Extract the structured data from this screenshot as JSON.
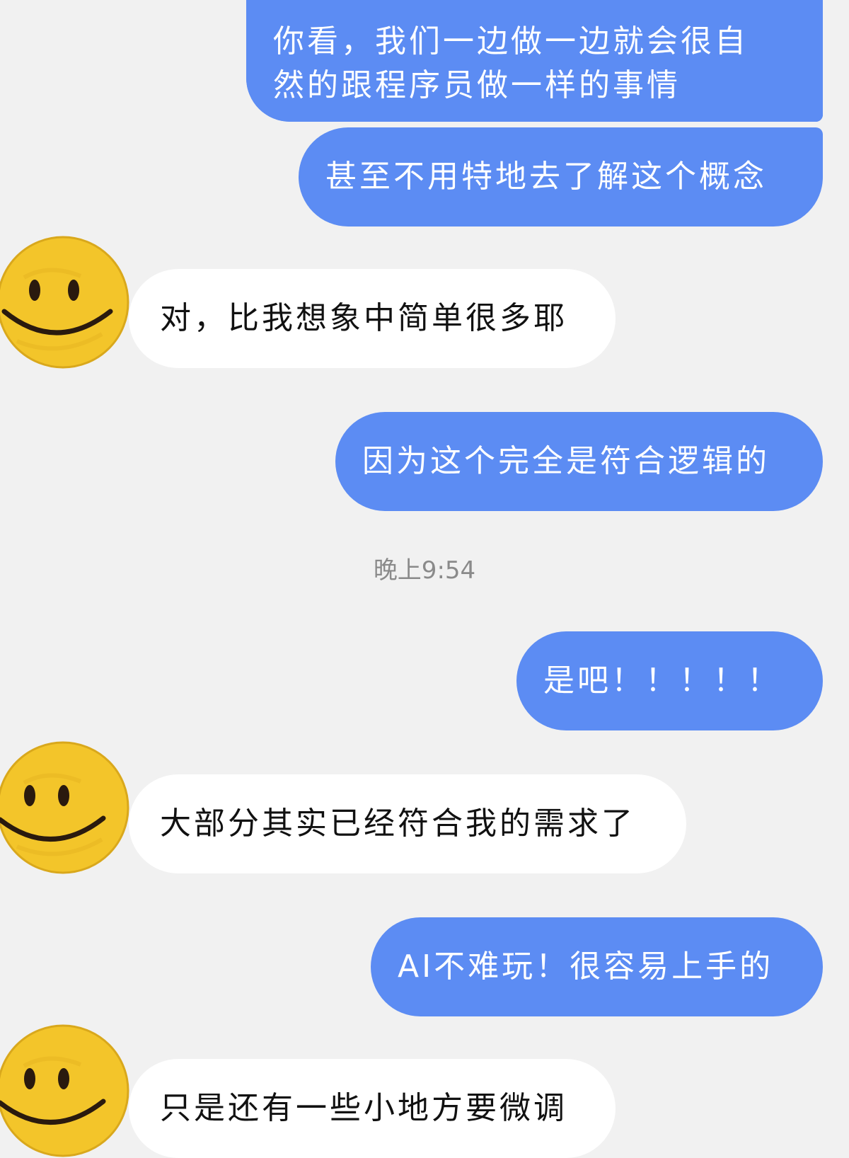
{
  "messages": [
    {
      "side": "out",
      "lines": [
        "你看，我们一边做一边就会很自",
        "然的跟程序员做一样的事情"
      ]
    },
    {
      "side": "out",
      "text": "甚至不用特地去了解这个概念"
    },
    {
      "side": "in",
      "text": "对，比我想象中简单很多耶"
    },
    {
      "side": "out",
      "text": "因为这个完全是符合逻辑的"
    },
    {
      "side": "out",
      "text": "是吧！！！！！"
    },
    {
      "side": "in",
      "text": "大部分其实已经符合我的需求了"
    },
    {
      "side": "out",
      "text": "AI不难玩！很容易上手的"
    },
    {
      "side": "in",
      "text": "只是还有一些小地方要微调"
    }
  ],
  "timestamp": "晚上9:54",
  "avatar_icon": "smiley-face-icon",
  "colors": {
    "background": "#f1f1f1",
    "outgoing_bubble": "#5c8cf3",
    "incoming_bubble": "#ffffff",
    "avatar_yellow": "#f3c52a"
  }
}
